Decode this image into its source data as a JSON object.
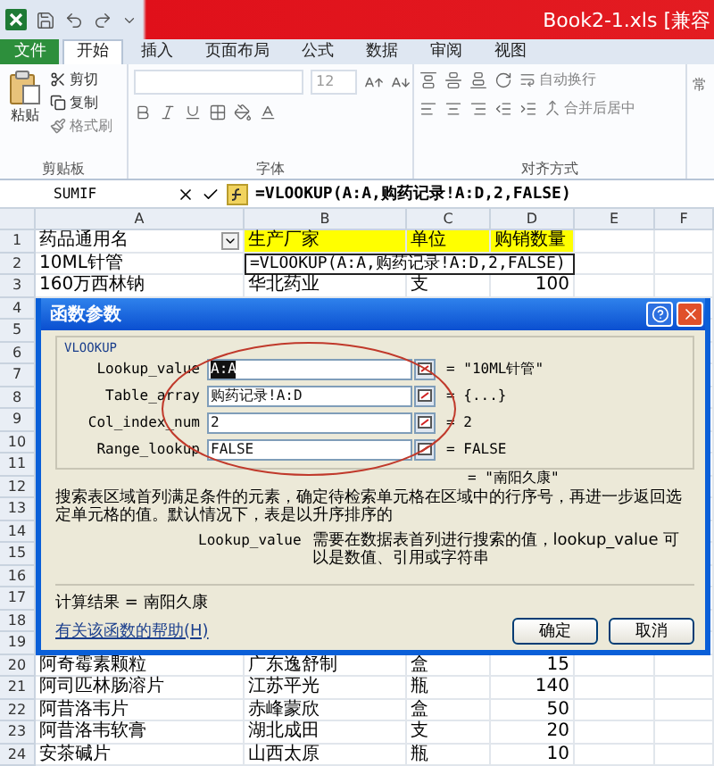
{
  "title_bar": {
    "title": "Book2-1.xls [兼容"
  },
  "ribbon_tabs": [
    {
      "label": "文件",
      "kind": "file",
      "selected": false
    },
    {
      "label": "开始",
      "kind": "tab",
      "selected": true
    },
    {
      "label": "插入",
      "kind": "tab",
      "selected": false
    },
    {
      "label": "页面布局",
      "kind": "tab",
      "selected": false
    },
    {
      "label": "公式",
      "kind": "tab",
      "selected": false
    },
    {
      "label": "数据",
      "kind": "tab",
      "selected": false
    },
    {
      "label": "审阅",
      "kind": "tab",
      "selected": false
    },
    {
      "label": "视图",
      "kind": "tab",
      "selected": false
    }
  ],
  "ribbon": {
    "clipboard": {
      "label": "剪贴板",
      "paste": "粘贴",
      "cut": "剪切",
      "copy": "复制",
      "format_painter": "格式刷"
    },
    "font": {
      "label": "字体",
      "size": "12"
    },
    "alignment": {
      "label": "对齐方式",
      "wrap_text": "自动换行",
      "merge_center": "合并后居中"
    },
    "number": {
      "format": "常"
    }
  },
  "formula_bar": {
    "name_box": "SUMIF",
    "formula": "=VLOOKUP(A:A,购药记录!A:D,2,FALSE)"
  },
  "sheet": {
    "columns": [
      "A",
      "B",
      "C",
      "D",
      "E",
      "F"
    ],
    "rows": [
      {
        "number": "1",
        "kind": "header",
        "cells": [
          {
            "text": "药品通用名",
            "highlighted": false,
            "filter": true
          },
          {
            "text": "生产厂家",
            "highlighted": true,
            "filter": false
          },
          {
            "text": "单位",
            "highlighted": true,
            "filter": false
          },
          {
            "text": "购销数量",
            "highlighted": true,
            "filter": false
          }
        ]
      },
      {
        "number": "2",
        "kind": "editing",
        "cells": [
          "10ML针管"
        ],
        "editing_cell": "=VLOOKUP(A:A,购药记录!A:D,2,FALSE)"
      },
      {
        "number": "3",
        "kind": "data",
        "cells": [
          "160万西林钠",
          "华北药业",
          "支",
          "100"
        ]
      },
      {
        "number": "4",
        "kind": "hidden"
      },
      {
        "number": "5",
        "kind": "hidden"
      },
      {
        "number": "6",
        "kind": "hidden"
      },
      {
        "number": "7",
        "kind": "hidden"
      },
      {
        "number": "8",
        "kind": "hidden"
      },
      {
        "number": "9",
        "kind": "hidden"
      },
      {
        "number": "10",
        "kind": "hidden"
      },
      {
        "number": "11",
        "kind": "hidden"
      },
      {
        "number": "12",
        "kind": "hidden"
      },
      {
        "number": "13",
        "kind": "hidden"
      },
      {
        "number": "14",
        "kind": "hidden"
      },
      {
        "number": "15",
        "kind": "hidden"
      },
      {
        "number": "16",
        "kind": "hidden"
      },
      {
        "number": "17",
        "kind": "hidden"
      },
      {
        "number": "18",
        "kind": "hidden"
      },
      {
        "number": "19",
        "kind": "hidden"
      },
      {
        "number": "20",
        "kind": "data",
        "cells": [
          "阿奇霉素颗粒",
          "广东逸舒制",
          "盒",
          "15"
        ]
      },
      {
        "number": "21",
        "kind": "data",
        "cells": [
          "阿司匹林肠溶片",
          "江苏平光",
          "瓶",
          "140"
        ]
      },
      {
        "number": "22",
        "kind": "data",
        "cells": [
          "阿昔洛韦片",
          "赤峰蒙欣",
          "盒",
          "50"
        ]
      },
      {
        "number": "23",
        "kind": "data",
        "cells": [
          "阿昔洛韦软膏",
          "湖北成田",
          "支",
          "20"
        ]
      },
      {
        "number": "24",
        "kind": "data",
        "cells": [
          "安茶碱片",
          "山西太原",
          "瓶",
          "10"
        ]
      }
    ]
  },
  "dialog": {
    "title": "函数参数",
    "function": "VLOOKUP",
    "arguments": [
      {
        "name": "Lookup_value",
        "value": "A:A",
        "result": "= \"10ML针管\"",
        "selected": true
      },
      {
        "name": "Table_array",
        "value": "购药记录!A:D",
        "result": "= {...}",
        "selected": false
      },
      {
        "name": "Col_index_num",
        "value": "2",
        "result": "= 2",
        "selected": false
      },
      {
        "name": "Range_lookup",
        "value": "FALSE",
        "result": "= FALSE",
        "selected": false
      }
    ],
    "formula_result": "= \"南阳久康\"",
    "description": "搜索表区域首列满足条件的元素，确定待检索单元格在区域中的行序号，再进一步返回选定单元格的值。默认情况下，表是以升序排序的",
    "argument_help": {
      "name": "Lookup_value",
      "text": "需要在数据表首列进行搜索的值，lookup_value 可以是数值、引用或字符串"
    },
    "calc_result": "计算结果 =  南阳久康",
    "help_link": "有关该函数的帮助(H)",
    "buttons": [
      "确定",
      "取消"
    ]
  }
}
